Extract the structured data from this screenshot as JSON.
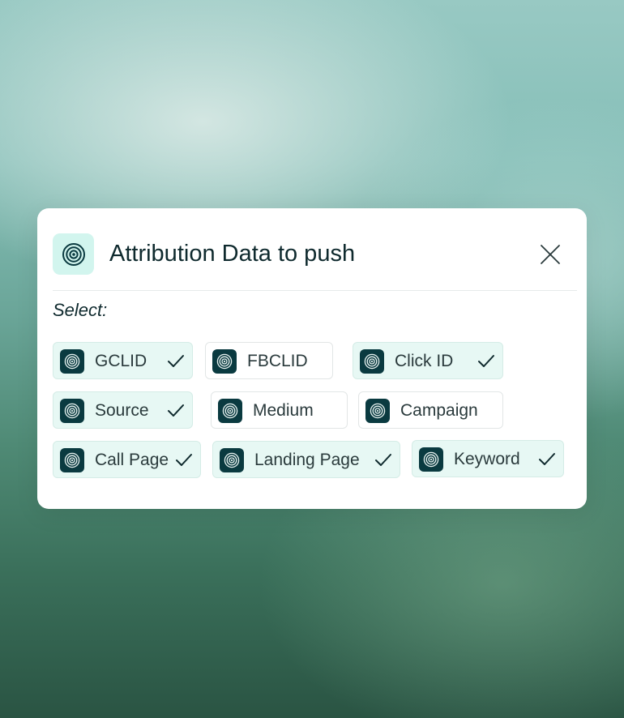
{
  "dialog": {
    "title": "Attribution Data to push",
    "logo_icon": "target-rings-icon",
    "close_icon": "close-icon",
    "select_label": "Select:"
  },
  "chips": [
    {
      "label": "GCLID",
      "selected": true,
      "icon": "target-rings-icon"
    },
    {
      "label": "FBCLID",
      "selected": false,
      "icon": "target-rings-icon"
    },
    {
      "label": "Click ID",
      "selected": true,
      "icon": "target-rings-icon"
    },
    {
      "label": "Source",
      "selected": true,
      "icon": "target-rings-icon"
    },
    {
      "label": "Medium",
      "selected": false,
      "icon": "target-rings-icon"
    },
    {
      "label": "Campaign",
      "selected": false,
      "icon": "target-rings-icon"
    },
    {
      "label": "Call Page",
      "selected": true,
      "icon": "target-rings-icon"
    },
    {
      "label": "Landing Page",
      "selected": true,
      "icon": "target-rings-icon"
    },
    {
      "label": "Keyword",
      "selected": true,
      "icon": "target-rings-icon"
    }
  ],
  "colors": {
    "accent_dark": "#0a3a40",
    "selected_bg": "#e7f8f4",
    "logo_bg": "#d2f5ee",
    "text": "#0f2a2e"
  }
}
